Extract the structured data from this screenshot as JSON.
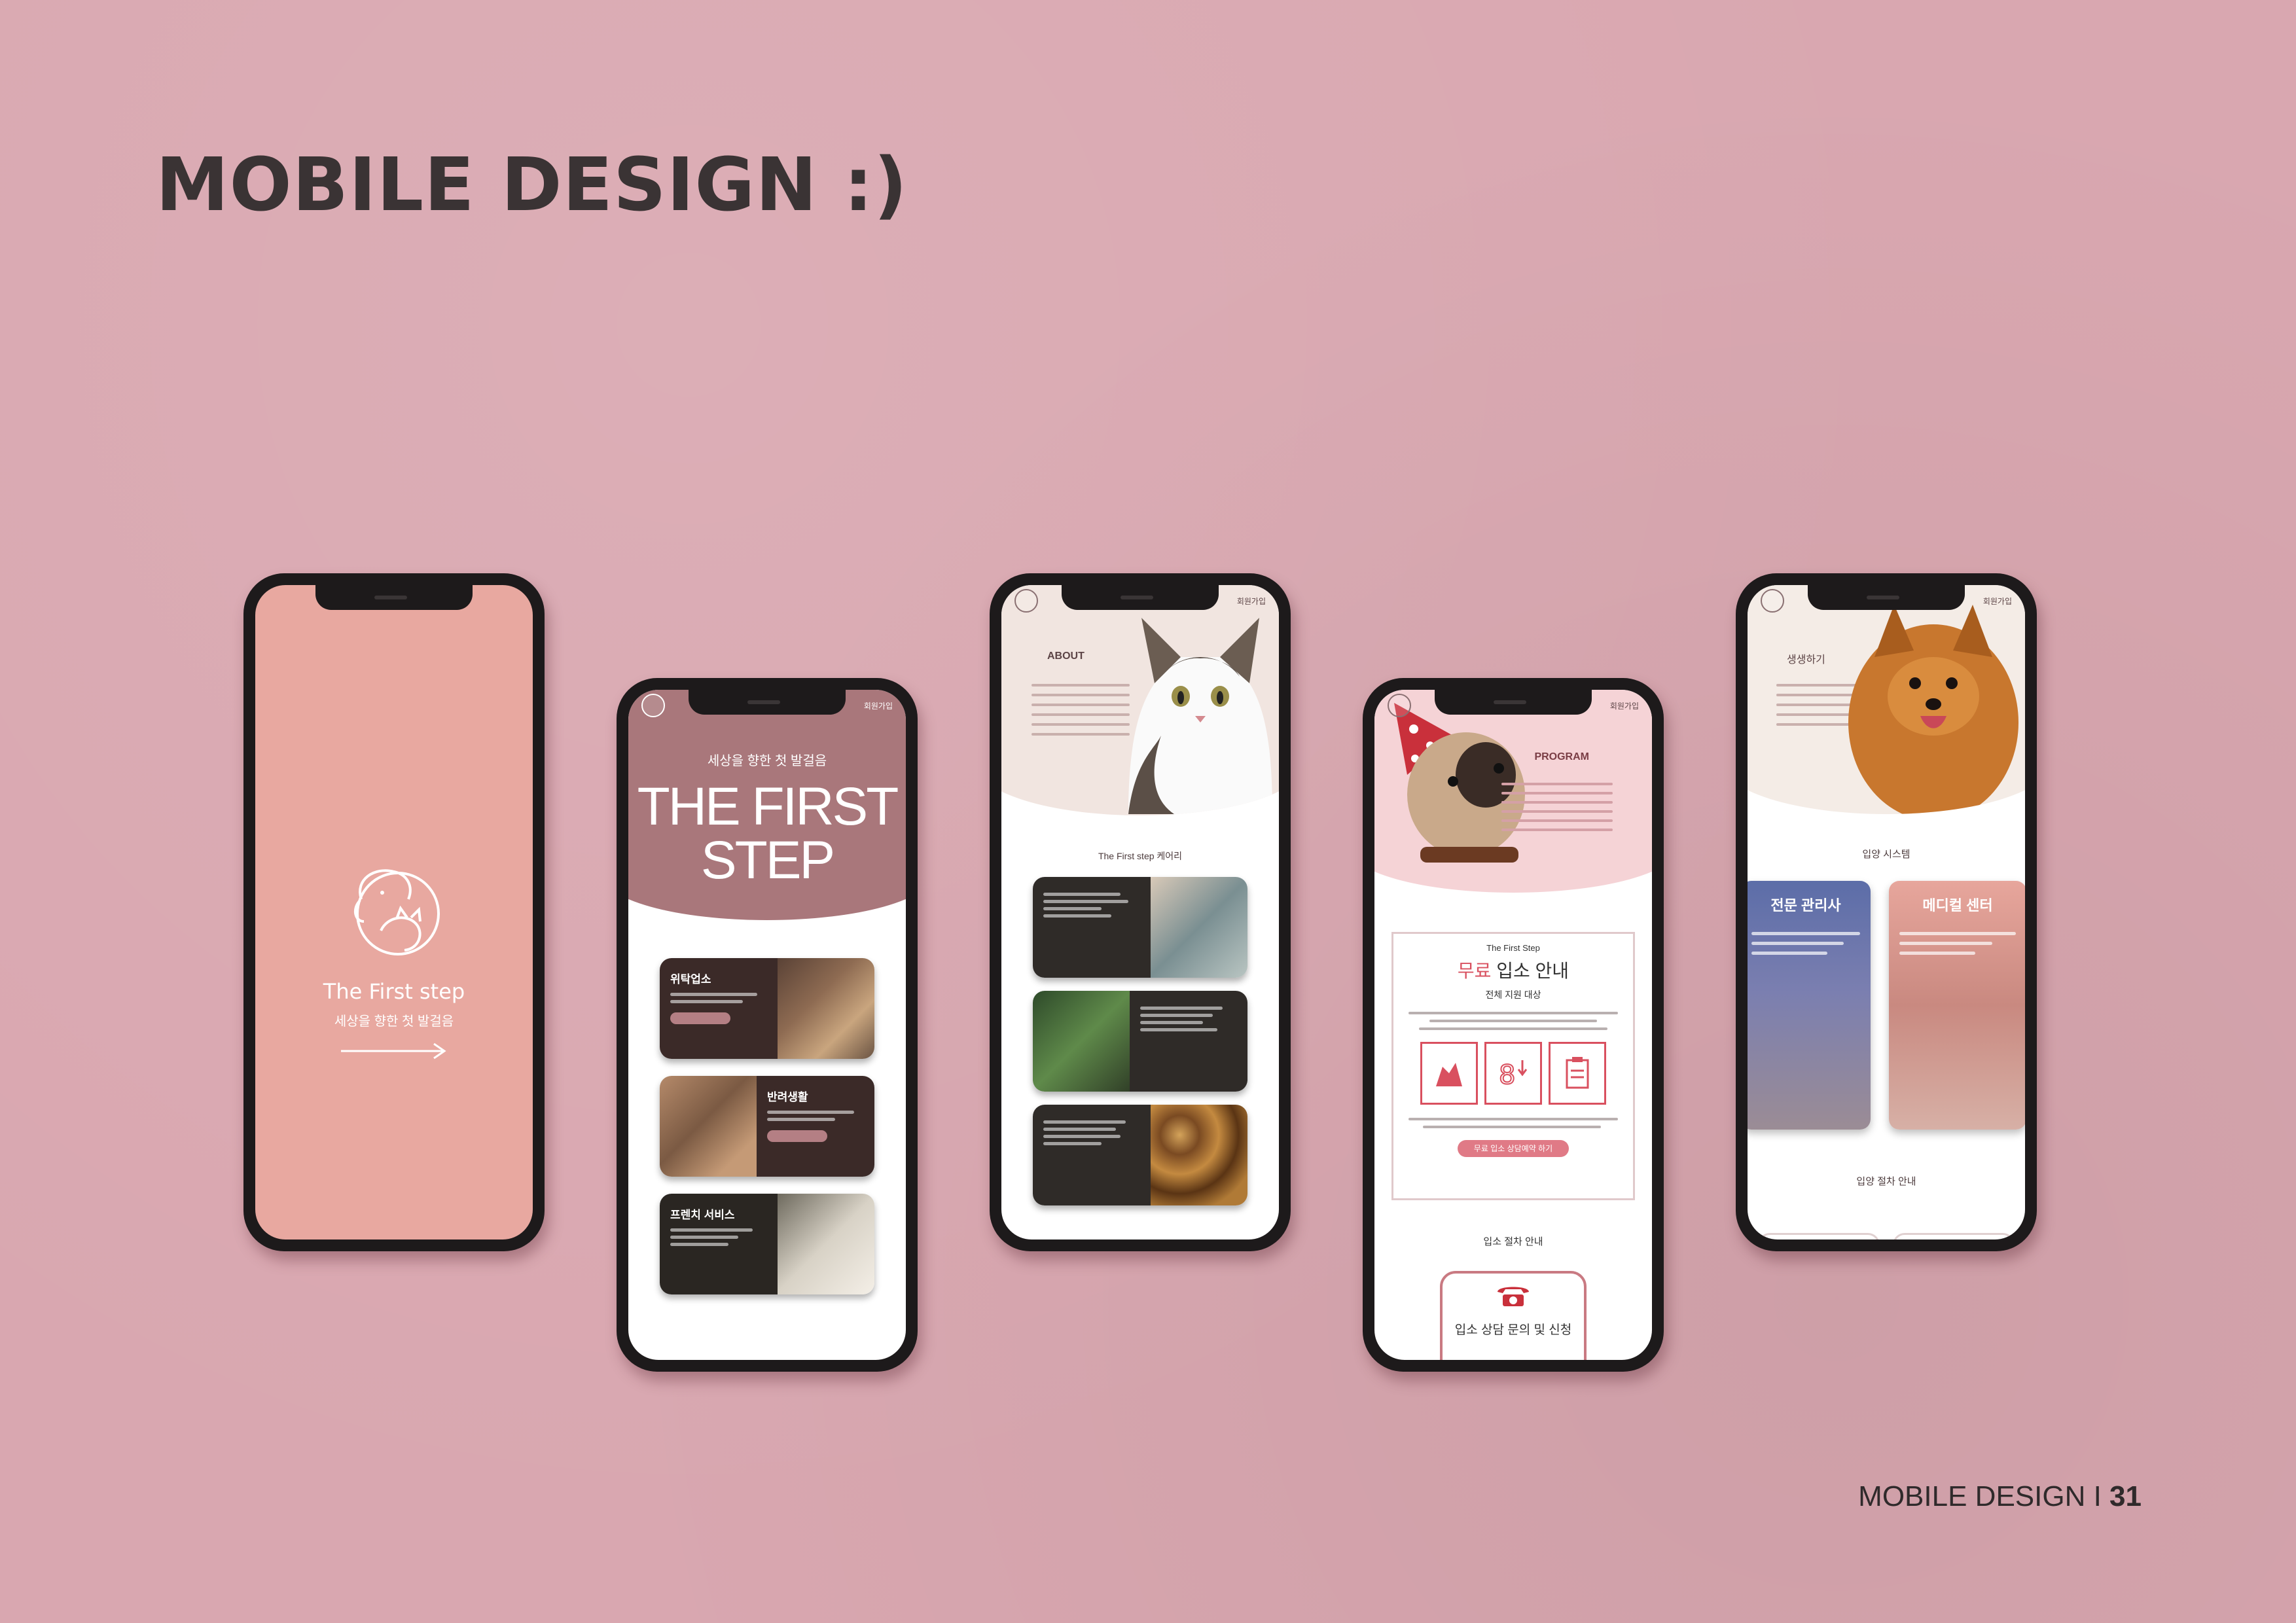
{
  "page": {
    "title": "MOBILE DESIGN :)",
    "footer_label": "MOBILE DESIGN",
    "footer_sep": " I ",
    "footer_page": "31"
  },
  "colors": {
    "background": "#d9a7b0",
    "splash": "#e8a8a0",
    "hero_mauve": "#a9777b",
    "accent_red": "#d9505f"
  },
  "phone1": {
    "brand": "The First step",
    "subtitle": "세상을 향한 첫 발걸음"
  },
  "phone2": {
    "menu": "회원가입",
    "tagline": "세상을 향한 첫 발걸음",
    "headline_1": "THE FIRST",
    "headline_2": "STEP",
    "cards": [
      {
        "title": "위탁업소"
      },
      {
        "title": "반려생활"
      },
      {
        "title": "프렌치 서비스"
      }
    ]
  },
  "phone3": {
    "menu": "회원가입",
    "about_title": "ABOUT",
    "section_subtitle": "The First step 케어리"
  },
  "phone4": {
    "menu": "회원가입",
    "program_title": "PROGRAM",
    "box_small": "The First Step",
    "box_big_highlight": "무료",
    "box_big_rest": " 입소 안내",
    "box_target": "전체 지원 대상",
    "button_label": "무료 입소 상담예약 하기",
    "section_title": "입소 절차 안내",
    "call_title": "입소 상담 문의 및 신청"
  },
  "phone5": {
    "menu": "회원가입",
    "hero_title": "생생하기",
    "section_1": "입양 시스템",
    "card_1": "전문 관리사",
    "card_2": "메디컬 센터",
    "section_2": "입양 절차 안내"
  }
}
